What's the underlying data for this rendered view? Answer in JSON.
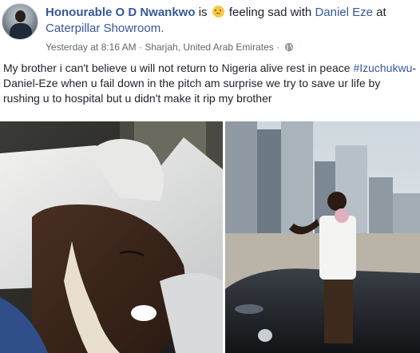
{
  "post": {
    "author": "Honourable O D Nwankwo",
    "is_text": "is",
    "feeling": "feeling sad with",
    "tagged": "Daniel Eze",
    "at_text": "at",
    "place": "Caterpillar Showroom.",
    "timestamp": "Yesterday at 8:16 AM",
    "location": "Sharjah, United Arab Emirates",
    "separator": "·",
    "icons": [
      "sad-face-icon",
      "globe-icon"
    ],
    "text_before": "My brother i can't believe u will not return to Nigeria alive rest in peace ",
    "hashtag": "#Izuchukwu",
    "text_after": "-Daniel-Eze when u fail down in the pitch am surprise we try to save ur life by rushing u to hospital but u didn't make it rip my brother"
  },
  "colors": {
    "link": "#365899",
    "text": "#1d2129",
    "meta": "#606770"
  }
}
